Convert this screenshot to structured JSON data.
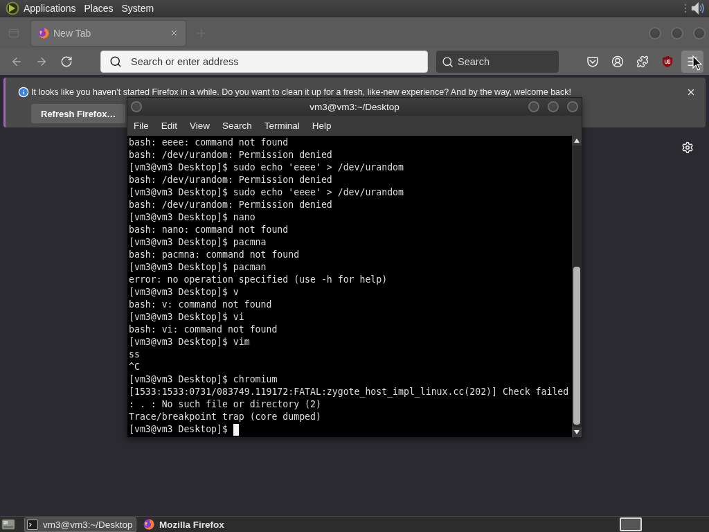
{
  "top_panel": {
    "menus": [
      "Applications",
      "Places",
      "System"
    ]
  },
  "browser": {
    "tabs": [
      {
        "label": "New Tab",
        "selected": true
      }
    ],
    "nav_buttons": [
      {
        "kind": "back",
        "disabled": true
      },
      {
        "kind": "forward",
        "disabled": true
      },
      {
        "kind": "reload",
        "disabled": false
      }
    ],
    "address_bar": {
      "placeholder": "Search or enter address"
    },
    "search_bar": {
      "placeholder": "Search"
    },
    "notification": {
      "message": "It looks like you haven’t started Firefox in a while. Do you want to clean it up for a fresh, like-new experience? And by the way, welcome back!",
      "button": "Refresh Firefox…"
    }
  },
  "terminal": {
    "title": "vm3@vm3:~/Desktop",
    "menus": [
      "File",
      "Edit",
      "View",
      "Search",
      "Terminal",
      "Help"
    ],
    "lines": [
      "bash: eeee: command not found",
      "bash: /dev/urandom: Permission denied",
      "[vm3@vm3 Desktop]$ sudo echo 'eeee' > /dev/urandom",
      "bash: /dev/urandom: Permission denied",
      "[vm3@vm3 Desktop]$ sudo echo 'eeee' > /dev/urandom",
      "bash: /dev/urandom: Permission denied",
      "[vm3@vm3 Desktop]$ nano",
      "bash: nano: command not found",
      "[vm3@vm3 Desktop]$ pacmna",
      "bash: pacmna: command not found",
      "[vm3@vm3 Desktop]$ pacman",
      "error: no operation specified (use -h for help)",
      "[vm3@vm3 Desktop]$ v",
      "bash: v: command not found",
      "[vm3@vm3 Desktop]$ vi",
      "bash: vi: command not found",
      "[vm3@vm3 Desktop]$ vim",
      "ss",
      "^C",
      "[vm3@vm3 Desktop]$ chromium",
      "[1533:1533:0731/083749.119172:FATAL:zygote_host_impl_linux.cc(202)] Check failed",
      ": . : No such file or directory (2)",
      "Trace/breakpoint trap (core dumped)"
    ],
    "prompt": "[vm3@vm3 Desktop]$",
    "cursor": true
  },
  "taskbar": {
    "tasks": [
      {
        "kind": "terminal",
        "label": "vm3@vm3:~/Desktop",
        "selected": true,
        "attention": false
      },
      {
        "kind": "browser",
        "label": "Mozilla Firefox",
        "selected": false,
        "attention": true
      }
    ]
  }
}
